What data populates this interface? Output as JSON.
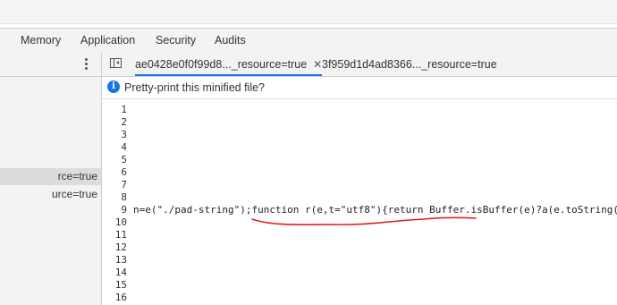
{
  "devtools_tabs": [
    "Memory",
    "Application",
    "Security",
    "Audits"
  ],
  "navigator": {
    "items": [
      "rce=true",
      "urce=true"
    ],
    "selected_index": 0
  },
  "editor": {
    "tabs": [
      {
        "label": "ae0428e0f0f99d8..._resource=true",
        "active": true,
        "closable": true
      },
      {
        "label": "3f959d1d4ad8366..._resource=true",
        "active": false,
        "closable": false
      }
    ],
    "infobar_icon": "info-icon",
    "infobar_text": "Pretty-print this minified file?",
    "line_numbers": [
      "1",
      "2",
      "3",
      "4",
      "5",
      "6",
      "7",
      "8",
      "9",
      "10",
      "11",
      "12",
      "13",
      "14",
      "15",
      "16"
    ],
    "code_line_number": "9",
    "code_text": "n=e(\"./pad-string\");function r(e,t=\"utf8\"){return Buffer.isBuffer(e)?a(e.toString(",
    "annotation_color": "#e02020",
    "accent_color": "#1a73e8"
  }
}
